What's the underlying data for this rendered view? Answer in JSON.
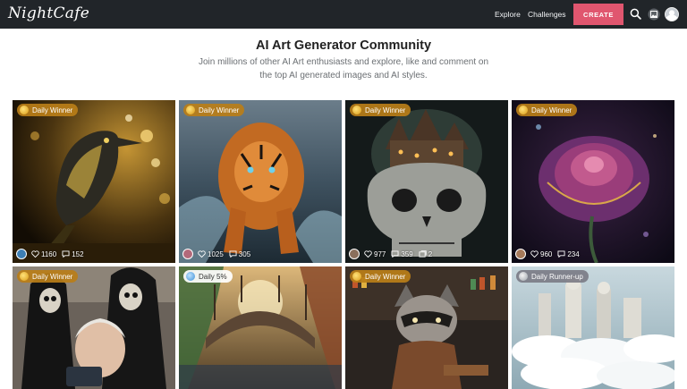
{
  "app": {
    "logo": "NightCafe",
    "nav": {
      "explore": "Explore",
      "challenges": "Challenges",
      "create": "CREATE"
    },
    "icons": [
      "search-icon",
      "gallery-icon",
      "avatar"
    ],
    "colors": {
      "topbar": "#212529",
      "create": "#e0566f",
      "badge_winner": "#ba7e18"
    }
  },
  "hero": {
    "title": "AI Art Generator Community",
    "description": "Join millions of other AI Art enthusiasts and explore, like and comment on the top AI generated images and AI styles."
  },
  "gallery": [
    {
      "badge": "Daily Winner",
      "likes": "1160",
      "comments": "152",
      "images": ""
    },
    {
      "badge": "Daily Winner",
      "likes": "1025",
      "comments": "305",
      "images": ""
    },
    {
      "badge": "Daily Winner",
      "likes": "977",
      "comments": "359",
      "images": "2"
    },
    {
      "badge": "Daily Winner",
      "likes": "960",
      "comments": "234",
      "images": ""
    },
    {
      "badge": "Daily Winner"
    },
    {
      "badge": "Daily 5%"
    },
    {
      "badge": "Daily Winner"
    },
    {
      "badge": "Daily Runner-up"
    }
  ]
}
